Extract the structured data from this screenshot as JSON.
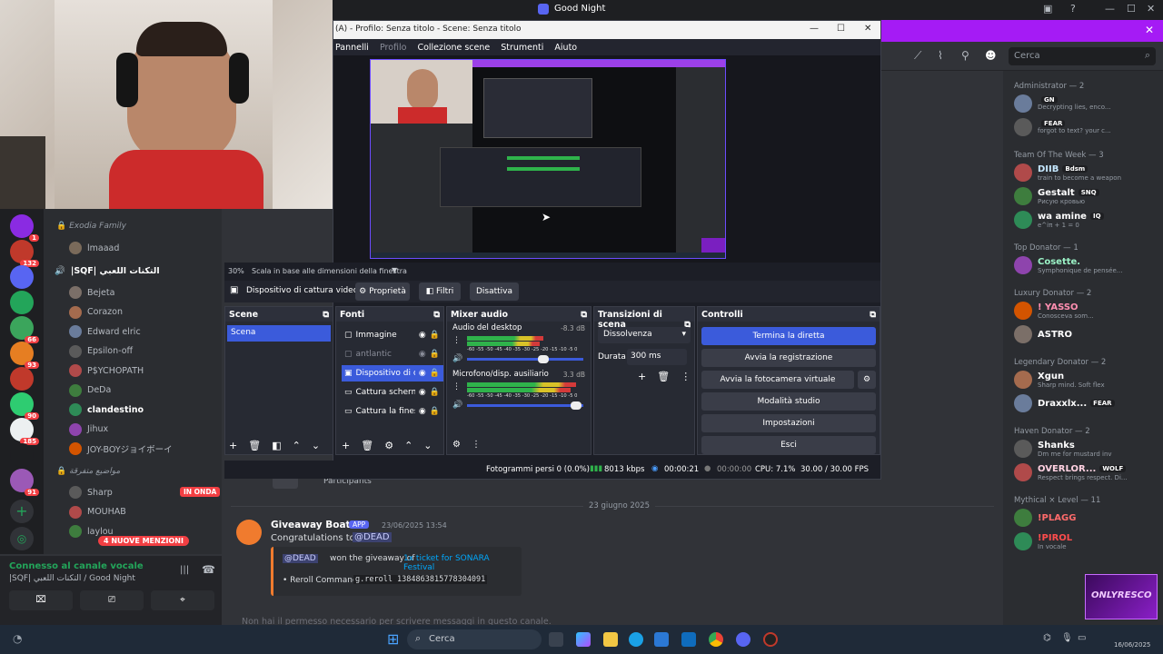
{
  "discord": {
    "window_title": "Good Night",
    "search_placeholder": "Cerca",
    "server_badges": [
      "1",
      "132",
      "",
      "",
      "66",
      "93",
      "",
      "90",
      "185",
      "",
      "91"
    ],
    "channels": {
      "category_1": "Exodia Family",
      "voice_channel_1_user": "lmaaad",
      "voice_channel_2": "|SQF| التكنات اللعبي",
      "users": [
        "Bejeta",
        "Corazon",
        "Edward elric",
        "Epsilon-off",
        "P$YCHOPATH",
        "DeDa",
        "clandestino",
        "Jihux",
        "JOY-BOYジョイボーイ"
      ],
      "category_2": "مواضيع متفرقة",
      "users_2": [
        "Sharp",
        "MOUHAB",
        "laylou"
      ],
      "live_badge": "IN ONDA",
      "mentions_badge": "4 NUOVE MENZIONI",
      "voice_connected": "Connesso al canale vocale",
      "voice_location": "|SQF| التكنات اللعبي / Good Night"
    },
    "chat": {
      "participants_label": "Participants",
      "date_divider": "23 giugno 2025",
      "author": "Giveaway Boat",
      "app_tag": "APP",
      "timestamp": "23/06/2025 13:54",
      "message": "Congratulations to",
      "mention": "@DEAD",
      "embed_line1_a": "@DEAD",
      "embed_line1_b": "won the giveaway of",
      "embed_line1_c": "1x ticket for SONARA Festival",
      "embed_line2_label": "• Reroll Command:",
      "embed_line2_cmd": "g.reroll 1384863815778304091",
      "no_permission": "Non hai il permesso necessario per scrivere messaggi in questo canale."
    },
    "members": {
      "groups": [
        {
          "title": "Administrator — 2",
          "members": [
            {
              "name": "",
              "status": "Decrypting lies, enco...",
              "tag": "GN"
            },
            {
              "name": "",
              "status": "forgot to text? your c...",
              "tag": "FEAR"
            }
          ]
        },
        {
          "title": "Team Of The Week — 3",
          "members": [
            {
              "name": "DIIB",
              "status": "train to become a weapon",
              "tag": "Bdsm"
            },
            {
              "name": "Gestalt",
              "status": "Рисую кровью",
              "tag": "SNQ"
            },
            {
              "name": "wa amine",
              "status": "e^iπ + 1 = 0",
              "tag": "IQ"
            }
          ]
        },
        {
          "title": "Top Donator — 1",
          "members": [
            {
              "name": "Cosette.",
              "status": "Symphonique de pensée...",
              "tag": ""
            }
          ]
        },
        {
          "title": "Luxury Donator — 2",
          "members": [
            {
              "name": "! YASSO",
              "status": "Conosceva som...",
              "tag": ""
            },
            {
              "name": "ASTRO",
              "status": "",
              "tag": ""
            }
          ]
        },
        {
          "title": "Legendary Donator — 2",
          "members": [
            {
              "name": "Xgun",
              "status": "Sharp mind. Soft flex",
              "tag": ""
            },
            {
              "name": "Draxxlx...",
              "status": "",
              "tag": "FEAR"
            }
          ]
        },
        {
          "title": "Haven Donator — 2",
          "members": [
            {
              "name": "Shanks",
              "status": "Dm me for mustard inv",
              "tag": ""
            },
            {
              "name": "OVERLOR...",
              "status": "Respect brings respect. Di...",
              "tag": "WOLF"
            }
          ]
        },
        {
          "title": "Mythical × Level — 11",
          "members": [
            {
              "name": "!PLAGG",
              "status": "",
              "tag": ""
            },
            {
              "name": "!PIROL",
              "status": "In vocale",
              "tag": ""
            }
          ]
        }
      ],
      "overlay_logo": "ONLYRESCO"
    }
  },
  "obs": {
    "title": "(A) - Profilo: Senza titolo - Scene: Senza titolo",
    "menu": [
      "Pannelli",
      "Profilo",
      "Collezione scene",
      "Strumenti",
      "Aiuto"
    ],
    "zoom": "30%",
    "zoom_hint": "Scala in base alle dimensioni della finestra",
    "source_bar": {
      "selected": "Dispositivo di cattura video",
      "properties": "Proprietà",
      "filters": "Filtri",
      "deactivate": "Disattiva"
    },
    "scenes": {
      "title": "Scene",
      "items": [
        "Scena"
      ]
    },
    "sources": {
      "title": "Fonti",
      "items": [
        "Immagine",
        "antlantic",
        "Dispositivo di c",
        "Cattura scherm",
        "Cattura la fines"
      ]
    },
    "mixer": {
      "title": "Mixer audio",
      "channels": [
        {
          "name": "Audio del desktop",
          "db": "-8.3 dB",
          "level": 0.66
        },
        {
          "name": "Microfono/disp. ausiliario",
          "db": "3.3 dB",
          "level": 0.94
        }
      ],
      "scale": "-60 -55 -50 -45 -40 -35 -30 -25 -20 -15 -10 -5 0"
    },
    "transitions": {
      "title": "Transizioni di scena",
      "selected": "Dissolvenza",
      "duration_label": "Durata",
      "duration": "300 ms"
    },
    "controls": {
      "title": "Controlli",
      "buttons": [
        "Termina la diretta",
        "Avvia la registrazione",
        "Avvia la fotocamera virtuale",
        "Modalità studio",
        "Impostazioni",
        "Esci"
      ]
    },
    "status": {
      "dropped": "Fotogrammi persi 0 (0.0%)",
      "bitrate": "8013 kbps",
      "live_time": "00:00:21",
      "rec_time": "00:00:00",
      "cpu": "CPU: 7.1%",
      "fps": "30.00 / 30.00 FPS"
    }
  },
  "taskbar": {
    "search": "Cerca",
    "date": "16/06/2025"
  },
  "colors": {
    "obs_primary": "#3b5bdb",
    "discord_accent": "#a51bf5",
    "green": "#23a55a",
    "red": "#f23f43"
  }
}
